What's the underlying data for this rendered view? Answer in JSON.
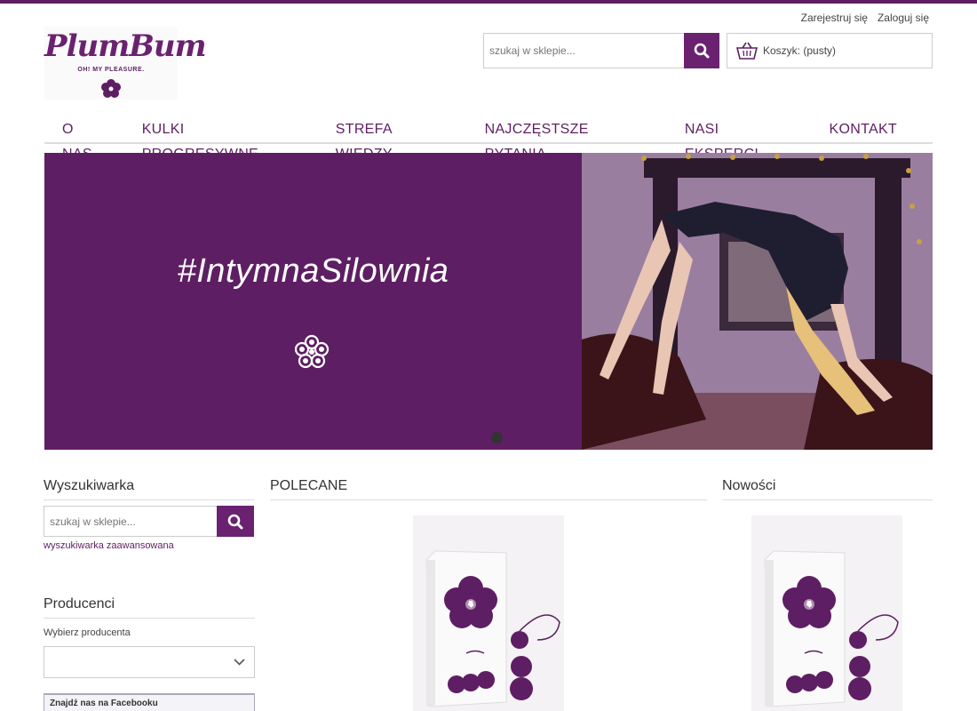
{
  "header": {
    "register_label": "Zarejestruj się",
    "login_label": "Zaloguj się",
    "logo": {
      "brand": "PlumBum",
      "tagline": "OH! MY PLEASURE."
    },
    "search_placeholder": "szukaj w sklepie...",
    "cart_label": "Koszyk: (pusty)"
  },
  "nav": {
    "items": [
      {
        "label": "O NAS"
      },
      {
        "label": "KULKI PROGRESYWNE"
      },
      {
        "label": "STREFA WIEDZY"
      },
      {
        "label": "NAJCZĘSTSZE PYTANIA"
      },
      {
        "label": "NASI EKSPERCI"
      },
      {
        "label": "KONTAKT"
      }
    ]
  },
  "banner": {
    "title": "#IntymnaSilownia"
  },
  "sidebar": {
    "search_title": "Wyszukiwarka",
    "search_placeholder": "szukaj w sklepie...",
    "advanced_link": "wyszukiwarka zaawansowana",
    "producers_title": "Producenci",
    "producers_label": "Wybierz producenta",
    "facebook_title": "Znajdź nas na Facebooku"
  },
  "main": {
    "featured_title": "POLECANE",
    "new_title": "Nowości"
  },
  "colors": {
    "brand_purple": "#5e1e63",
    "accent": "#6a2270"
  }
}
